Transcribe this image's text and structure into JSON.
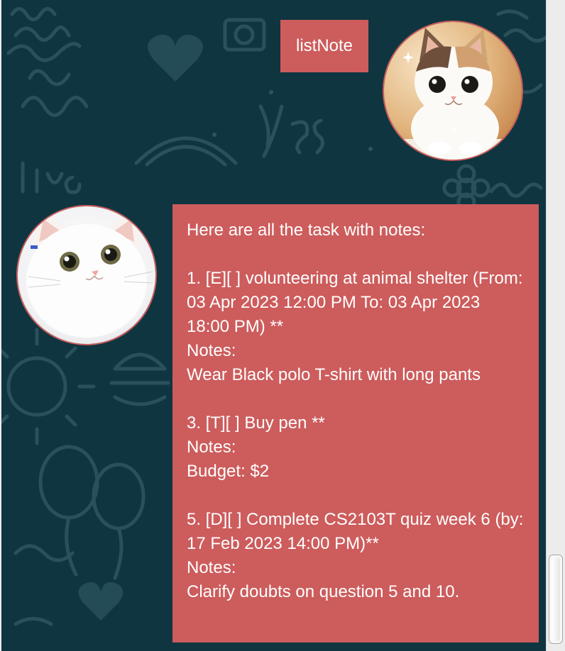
{
  "theme": {
    "bubble_color": "#cd5c5c",
    "background_color": "#0f3540",
    "text_color": "#ffffff"
  },
  "user_message": {
    "text": "listNote",
    "avatar_icon": "calico-kitten-avatar"
  },
  "bot_message": {
    "text": "Here are all the task with notes:\n\n1. [E][ ] volunteering at animal shelter (From: 03 Apr 2023 12:00 PM To: 03 Apr 2023 18:00 PM) **\nNotes:\nWear Black polo T-shirt with long pants\n\n3. [T][ ] Buy pen **\nNotes:\nBudget: $2\n\n5. [D][ ] Complete CS2103T quiz week 6 (by: 17 Feb 2023 14:00 PM)**\nNotes:\nClarify doubts on question 5 and 10.",
    "avatar_icon": "white-kitten-avatar"
  },
  "scrollbar": {
    "position": "bottom"
  }
}
